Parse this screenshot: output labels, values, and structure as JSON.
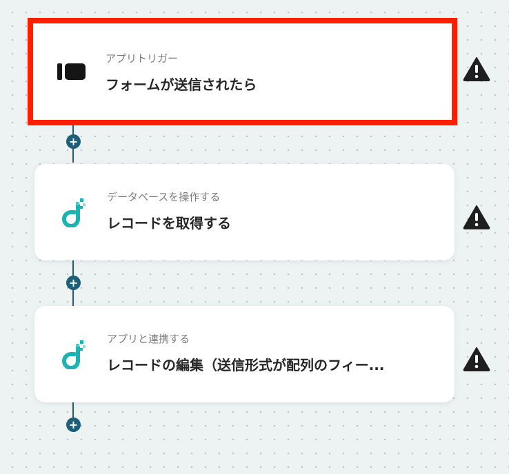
{
  "flow": {
    "steps": [
      {
        "subtitle": "アプリトリガー",
        "title": "フォームが送信されたら",
        "icon": "form-trigger-icon",
        "selected": true
      },
      {
        "subtitle": "データベースを操作する",
        "title": "レコードを取得する",
        "icon": "yoom-database-icon",
        "selected": false
      },
      {
        "subtitle": "アプリと連携する",
        "title": "レコードの編集（送信形式が配列のフィー...",
        "icon": "yoom-database-icon",
        "selected": false
      }
    ],
    "add_button_label": "+",
    "warning_icon": "warning-icon"
  },
  "colors": {
    "highlight": "#ff1e00",
    "connector": "#1d5f78",
    "brand_teal": "#1bb3b3",
    "warning": "#1f1f1f"
  }
}
